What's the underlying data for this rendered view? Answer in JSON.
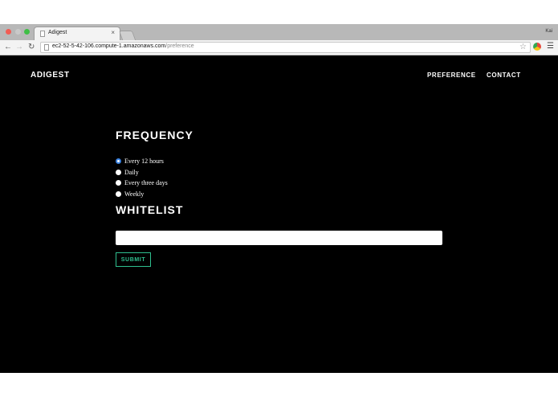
{
  "browser": {
    "tab_title": "Adigest",
    "tab_close": "×",
    "profile_name": "Kai",
    "url_host": "ec2-52-5-42-106.compute-1.amazonaws.com",
    "url_path": "/preference",
    "icons": [
      "back-arrow-icon",
      "forward-arrow-icon",
      "reload-icon",
      "page-icon",
      "star-icon",
      "extension-icon",
      "menu-icon"
    ]
  },
  "site": {
    "brand": "ADIGEST",
    "nav": [
      {
        "label": "PREFERENCE"
      },
      {
        "label": "CONTACT"
      }
    ]
  },
  "frequency": {
    "title": "FREQUENCY",
    "options": [
      {
        "label": "Every 12 hours",
        "checked": true
      },
      {
        "label": "Daily",
        "checked": false
      },
      {
        "label": "Every three days",
        "checked": false
      },
      {
        "label": "Weekly",
        "checked": false
      }
    ]
  },
  "whitelist": {
    "title": "WHITELIST",
    "input_value": "",
    "submit_label": "SUBMIT"
  },
  "colors": {
    "page_background": "#000000",
    "accent": "#2fbf8f",
    "radio_checked": "#3b82e0"
  }
}
